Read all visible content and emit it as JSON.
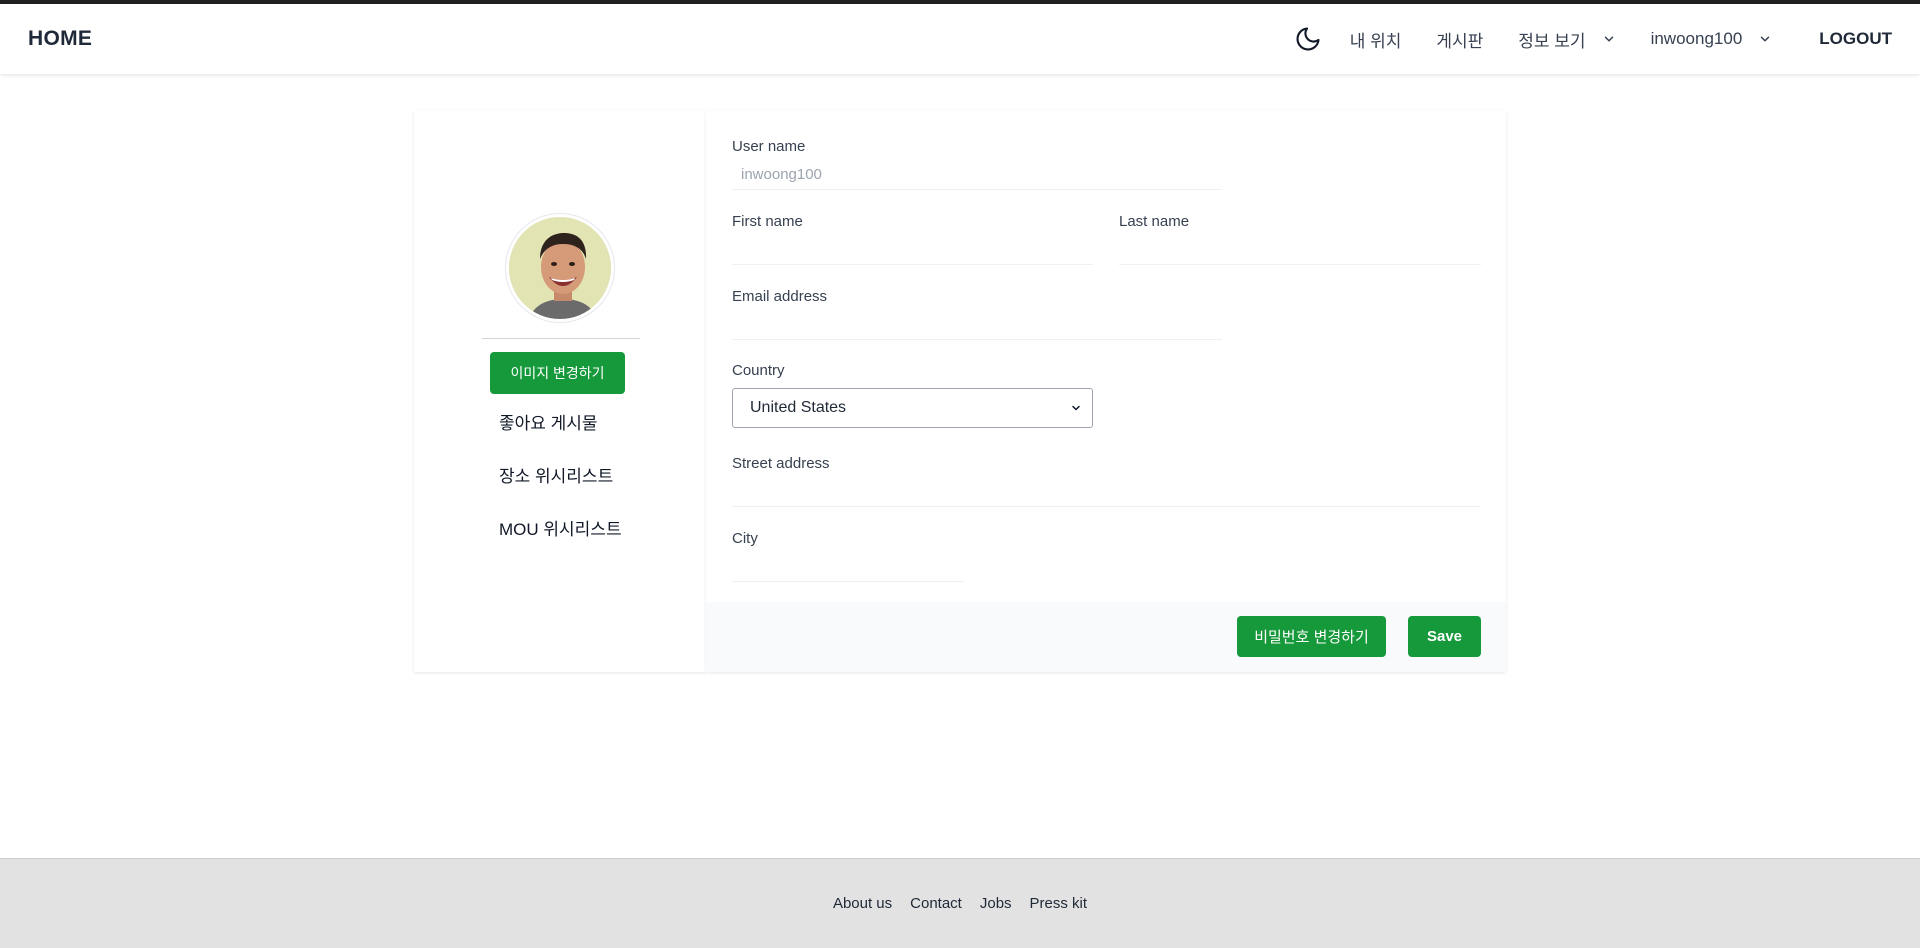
{
  "navbar": {
    "brand": "HOME",
    "theme_icon": "moon-icon",
    "links": {
      "my_location": "내 위치",
      "board": "게시판",
      "info": "정보 보기"
    },
    "username": "inwoong100",
    "logout": "LOGOUT"
  },
  "sidebar": {
    "avatar_icon": "user-avatar",
    "change_image": "이미지 변경하기",
    "items": [
      "좋아요 게시물",
      "장소 위시리스트",
      "MOU 위시리스트"
    ]
  },
  "form": {
    "username_label": "User name",
    "username_value": "inwoong100",
    "first_name_label": "First name",
    "first_name_value": "",
    "last_name_label": "Last name",
    "last_name_value": "",
    "email_label": "Email address",
    "email_value": "",
    "country_label": "Country",
    "country_selected": "United States",
    "street_label": "Street address",
    "street_value": "",
    "city_label": "City",
    "city_value": "",
    "change_password": "비밀번호 변경하기",
    "save": "Save"
  },
  "footer": {
    "links": [
      "About us",
      "Contact",
      "Jobs",
      "Press kit"
    ]
  },
  "colors": {
    "accent": "#16993a",
    "footer_bg": "#e2e2e2"
  }
}
